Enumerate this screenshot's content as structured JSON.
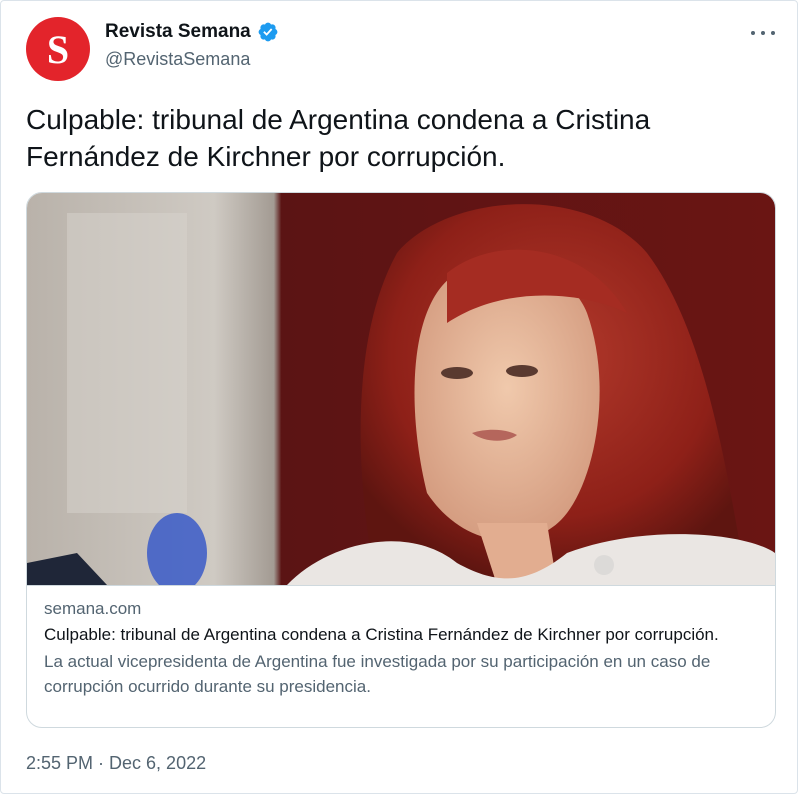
{
  "author": {
    "avatar_letter": "S",
    "display_name": "Revista Semana",
    "handle": "@RevistaSemana",
    "verified_icon": "verified-badge-icon",
    "avatar_color": "#e3242b",
    "verified_color": "#1d9bf0"
  },
  "tweet": {
    "text": "Culpable: tribunal de Argentina condena a Cristina Fernández de Kirchner por corrupción.",
    "timestamp": "2:55 PM · Dec 6, 2022"
  },
  "card": {
    "domain": "semana.com",
    "title": "Culpable: tribunal de Argentina condena a Cristina Fernández de Kirchner por corrupción.",
    "description": "La actual vicepresidenta de Argentina fue investigada por su participación en un caso de corrupción ocurrido durante su presidencia.",
    "image_icon": "article-photo"
  },
  "menu": {
    "icon": "more-options-icon"
  }
}
